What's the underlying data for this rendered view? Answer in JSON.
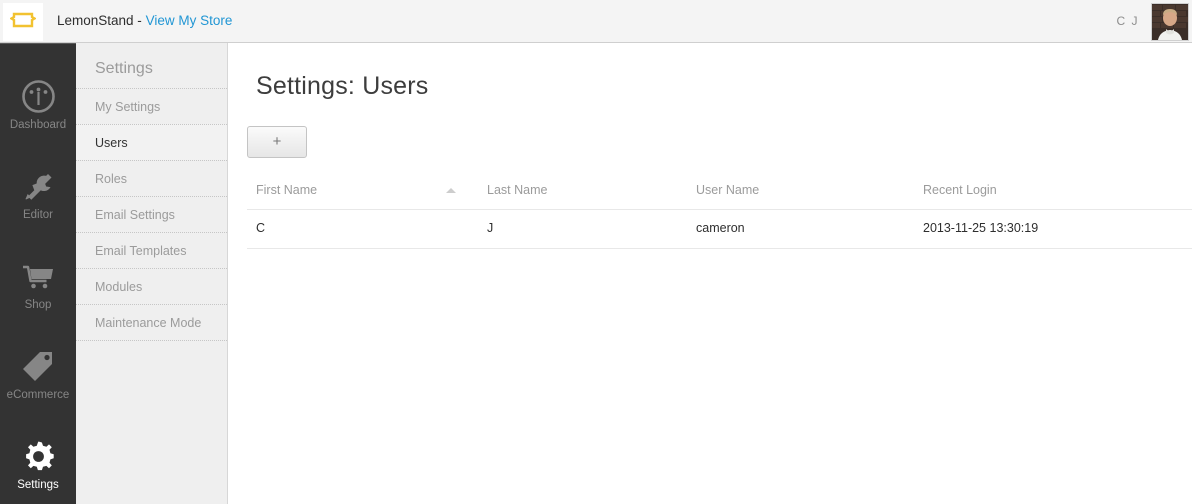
{
  "topbar": {
    "logo_icon": "lemonstand-logo-icon",
    "brand_name": "LemonStand - ",
    "store_link": "View My Store",
    "user_initials": "C J",
    "avatar_alt": "user-avatar-photo",
    "link_color": "#2196d4",
    "logo_color": "#f2c230"
  },
  "rail": {
    "items": [
      {
        "label": "Dashboard",
        "icon": "gauge-icon",
        "active": false
      },
      {
        "label": "Editor",
        "icon": "tools-icon",
        "active": false
      },
      {
        "label": "Shop",
        "icon": "shopping-cart-icon",
        "active": false
      },
      {
        "label": "eCommerce",
        "icon": "price-tag-icon",
        "active": false
      },
      {
        "label": "Settings",
        "icon": "gear-icon",
        "active": true
      }
    ]
  },
  "nav": {
    "title": "Settings",
    "items": [
      {
        "label": "My Settings",
        "active": false
      },
      {
        "label": "Users",
        "active": true
      },
      {
        "label": "Roles",
        "active": false
      },
      {
        "label": "Email Settings",
        "active": false
      },
      {
        "label": "Email Templates",
        "active": false
      },
      {
        "label": "Modules",
        "active": false
      },
      {
        "label": "Maintenance Mode",
        "active": false
      }
    ]
  },
  "main": {
    "page_title": "Settings: Users",
    "add_button_label": "+",
    "table": {
      "columns": [
        {
          "label": "First Name",
          "sorted": "asc"
        },
        {
          "label": "Last Name",
          "sorted": "none"
        },
        {
          "label": "User Name",
          "sorted": "none"
        },
        {
          "label": "Recent Login",
          "sorted": "none"
        }
      ],
      "rows": [
        {
          "first_name": "C",
          "last_name": "J",
          "user_name": "cameron",
          "recent_login": "2013-11-25 13:30:19"
        }
      ]
    }
  }
}
